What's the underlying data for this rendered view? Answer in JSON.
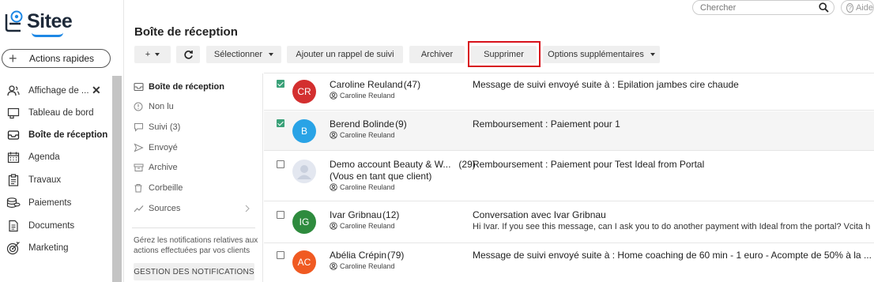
{
  "brand": {
    "name": "Sitee"
  },
  "quick_actions": {
    "label": "Actions rapides"
  },
  "nav": {
    "items": [
      {
        "label": "Affichage de ...",
        "icon": "people-icon",
        "closable": true
      },
      {
        "label": "Tableau de bord",
        "icon": "dashboard-icon"
      },
      {
        "label": "Boîte de réception",
        "icon": "inbox-icon",
        "active": true
      },
      {
        "label": "Agenda",
        "icon": "calendar-icon"
      },
      {
        "label": "Travaux",
        "icon": "clipboard-icon"
      },
      {
        "label": "Paiements",
        "icon": "coins-icon"
      },
      {
        "label": "Documents",
        "icon": "document-icon"
      },
      {
        "label": "Marketing",
        "icon": "target-icon"
      }
    ]
  },
  "search": {
    "placeholder": "Chercher"
  },
  "help": {
    "label": "Aide"
  },
  "page_title": "Boîte de réception",
  "toolbar": {
    "add_label": "+",
    "select_label": "Sélectionner",
    "reminder_label": "Ajouter un rappel de suivi",
    "archive_label": "Archiver",
    "delete_label": "Supprimer",
    "more_label": "Options supplémentaires"
  },
  "folders": {
    "items": [
      {
        "label": "Boîte de réception",
        "icon": "inbox-icon",
        "active": true
      },
      {
        "label": "Non lu",
        "icon": "info-icon"
      },
      {
        "label": "Suivi (3)",
        "icon": "chat-icon"
      },
      {
        "label": "Envoyé",
        "icon": "send-icon"
      },
      {
        "label": "Archive",
        "icon": "archive-icon"
      },
      {
        "label": "Corbeille",
        "icon": "trash-icon"
      },
      {
        "label": "Sources",
        "icon": "trend-icon",
        "has_chevron": true
      }
    ],
    "notif_text": "Gérez les notifications relatives aux actions effectuées par vos clients",
    "notif_button": "GESTION DES NOTIFICATIONS"
  },
  "messages": [
    {
      "checked": true,
      "selected": false,
      "initials": "CR",
      "avatar_color": "#d32f2f",
      "sender": "Caroline Reuland",
      "count": "(47)",
      "assignee": "Caroline Reuland",
      "subject": "Message de suivi envoyé suite à : Epilation jambes cire chaude",
      "preview": ""
    },
    {
      "checked": true,
      "selected": true,
      "initials": "B",
      "avatar_color": "#29a3e6",
      "sender": "Berend Bolinde",
      "count": "(9)",
      "assignee": "Caroline Reuland",
      "subject": "Remboursement : Paiement pour 1",
      "preview": ""
    },
    {
      "checked": false,
      "selected": false,
      "initials": "",
      "avatar_color": "#e3e7f0",
      "sender": "Demo account Beauty & W...",
      "count": "(29)",
      "sender_line2": "(Vous en tant que client)",
      "assignee": "Caroline Reuland",
      "subject": "Remboursement : Paiement pour Test Ideal from Portal",
      "preview": ""
    },
    {
      "checked": false,
      "selected": false,
      "initials": "IG",
      "avatar_color": "#2e8b3e",
      "sender": "Ivar Gribnau",
      "count": "(12)",
      "assignee": "Caroline Reuland",
      "subject": "Conversation avec Ivar Gribnau",
      "preview": "Hi Ivar. If you see this  message, can I ask you to do another payment with Ideal from the portal? Vcita h"
    },
    {
      "checked": false,
      "selected": false,
      "initials": "AC",
      "avatar_color": "#f05a22",
      "sender": "Abélia Crépin",
      "count": "(79)",
      "assignee": "Caroline Reuland",
      "subject": "Message de suivi envoyé suite à : Home coaching de 60 min - 1 euro - Acompte de 50% à la ...",
      "preview": ""
    }
  ]
}
